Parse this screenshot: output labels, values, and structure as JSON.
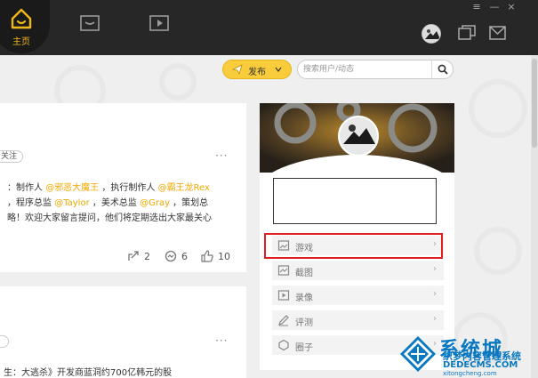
{
  "colors": {
    "accent": "#f8cc3a",
    "mention": "#f0a800",
    "topbar": "#272727",
    "highlight": "#e02020",
    "watermark": "#0a78c0"
  },
  "nav": {
    "home_label": "主页",
    "items": [
      {
        "icon": "inbox-icon"
      },
      {
        "icon": "video-icon"
      }
    ]
  },
  "window_controls": {
    "menu": "≡",
    "minimize": "—",
    "close": "×"
  },
  "header_icons": [
    "avatar",
    "chat-icon",
    "mail-icon"
  ],
  "toolbar": {
    "publish_label": "发布",
    "search_placeholder": "搜索用户/动态"
  },
  "feed": {
    "card1": {
      "follow_label": "关注",
      "lines": [
        [
          {
            "t": "：制作人 "
          },
          {
            "t": "@邪恶大魔王",
            "m": true
          },
          {
            "t": "，执行制作人 "
          },
          {
            "t": "@霸王龙Rex",
            "m": true
          }
        ],
        [
          {
            "t": "，程序总监 "
          },
          {
            "t": "@Taylor",
            "m": true
          },
          {
            "t": "，美术总监 "
          },
          {
            "t": "@Gray",
            "m": true
          },
          {
            "t": "，策划总"
          }
        ],
        [
          {
            "t": "略！欢迎大家留言提问，他们将定期选出大家最关心"
          }
        ]
      ],
      "stats": {
        "share": "2",
        "comments": "6",
        "likes": "10"
      }
    },
    "card2": {
      "line": "生：大逃杀》开发商蓝洞约700亿韩元的股"
    }
  },
  "sidebar_menu": [
    {
      "label": "游戏",
      "icon": "image-icon"
    },
    {
      "label": "截图",
      "icon": "screenshot-icon"
    },
    {
      "label": "录像",
      "icon": "play-icon"
    },
    {
      "label": "评测",
      "icon": "pencil-icon"
    },
    {
      "label": "圈子",
      "icon": "circle-icon"
    }
  ],
  "watermark": {
    "title": "系统城",
    "subtitle": "织梦内容管理系统",
    "url": "DEDECMS.COM",
    "url2": "xitongcheng.com"
  }
}
